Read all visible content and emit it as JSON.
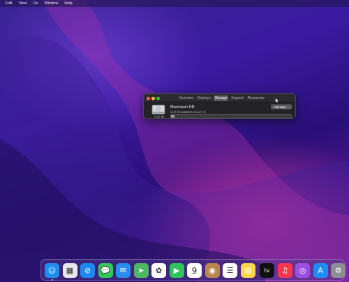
{
  "menubar": {
    "items": [
      "Edit",
      "View",
      "Go",
      "Window",
      "Help"
    ]
  },
  "window": {
    "tabs": [
      "Overview",
      "Displays",
      "Storage",
      "Support",
      "Resources"
    ],
    "active_tab": "Storage",
    "volume": {
      "name": "Macintosh HD",
      "available": "1.09 TB available of 1.12 TB",
      "disk_size": "1.12 TB",
      "disk_type": "Fusion Drive",
      "used_fraction": 0.03
    },
    "manage_label": "Manage..."
  },
  "dock": {
    "apps": [
      {
        "name": "finder-icon",
        "color": "#1f8df0",
        "glyph": "☺"
      },
      {
        "name": "launchpad-icon",
        "color": "#e8e8ec",
        "glyph": "▦"
      },
      {
        "name": "safari-icon",
        "color": "#1e88f5",
        "glyph": "⊘"
      },
      {
        "name": "messages-icon",
        "color": "#34c759",
        "glyph": "💬"
      },
      {
        "name": "mail-icon",
        "color": "#2b8cf2",
        "glyph": "✉"
      },
      {
        "name": "maps-icon",
        "color": "#4cb863",
        "glyph": "➤"
      },
      {
        "name": "photos-icon",
        "color": "#ffffff",
        "glyph": "✿"
      },
      {
        "name": "facetime-icon",
        "color": "#2ec55a",
        "glyph": "▶"
      },
      {
        "name": "calendar-icon",
        "color": "#ffffff",
        "glyph": "9"
      },
      {
        "name": "contacts-icon",
        "color": "#b8864e",
        "glyph": "◉"
      },
      {
        "name": "reminders-icon",
        "color": "#ffffff",
        "glyph": "☰"
      },
      {
        "name": "notes-icon",
        "color": "#fbd84a",
        "glyph": "▤"
      },
      {
        "name": "tv-icon",
        "color": "#111111",
        "glyph": "tv"
      },
      {
        "name": "music-icon",
        "color": "#f8364f",
        "glyph": "♫"
      },
      {
        "name": "podcasts-icon",
        "color": "#9b4fe0",
        "glyph": "◎"
      },
      {
        "name": "app-store-icon",
        "color": "#1c8ef5",
        "glyph": "A"
      },
      {
        "name": "system-preferences-icon",
        "color": "#8e8e93",
        "glyph": "⚙"
      }
    ]
  }
}
